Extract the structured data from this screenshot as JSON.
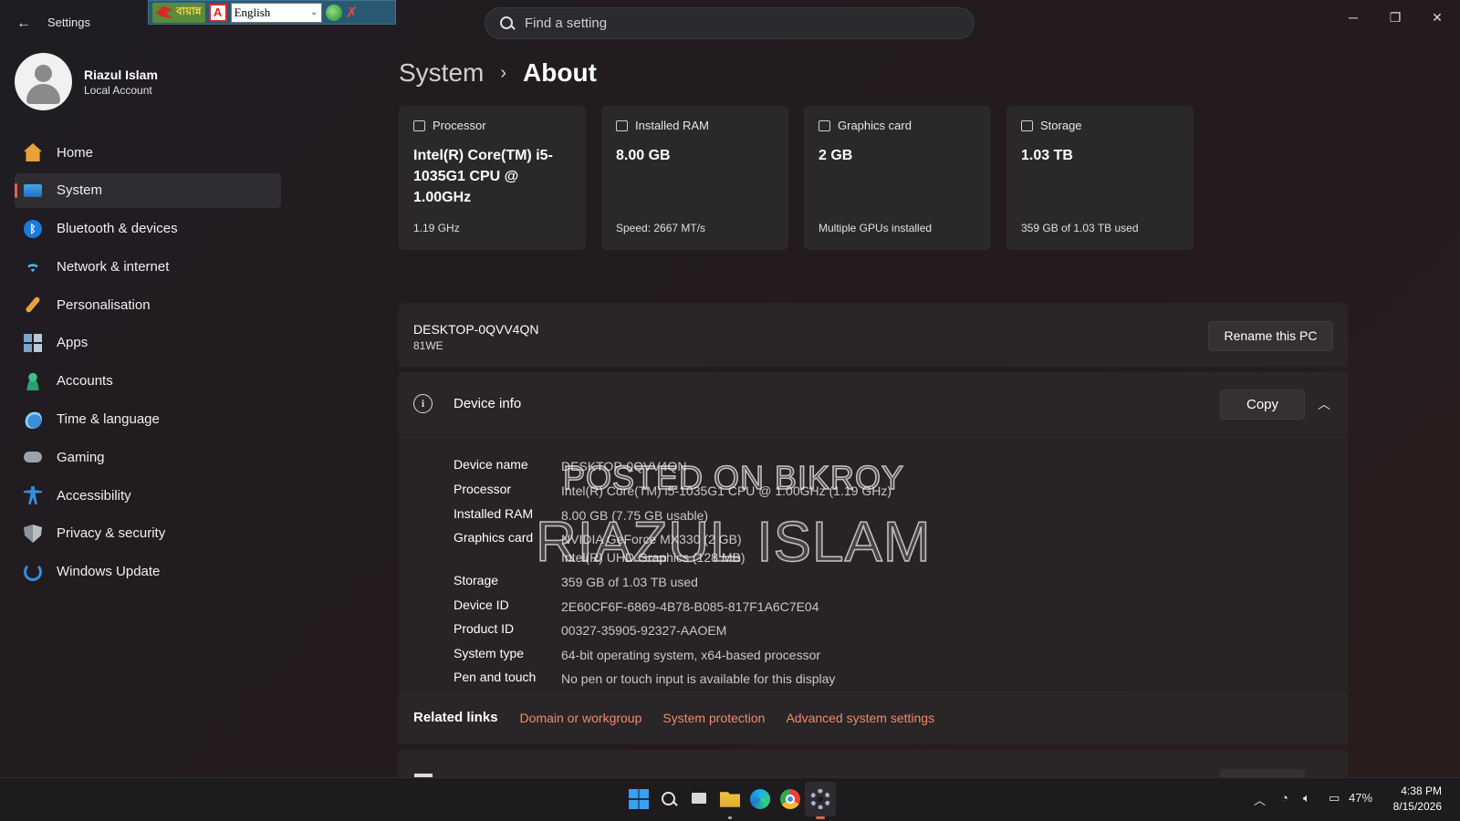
{
  "window": {
    "app_title": "Settings",
    "back_icon": "arrow-left-icon",
    "minimize_icon": "minimize-icon",
    "restore_icon": "restore-icon",
    "close_icon": "close-icon"
  },
  "ime_toolbar": {
    "brand_text": "বায়ান্ন",
    "language": "English"
  },
  "search": {
    "placeholder": "Find a setting"
  },
  "user": {
    "name": "Riazul Islam",
    "account_type": "Local Account"
  },
  "sidebar": {
    "items": [
      {
        "label": "Home",
        "icon": "home-icon",
        "active": false
      },
      {
        "label": "System",
        "icon": "system-icon",
        "active": true
      },
      {
        "label": "Bluetooth & devices",
        "icon": "bluetooth-icon",
        "active": false
      },
      {
        "label": "Network & internet",
        "icon": "wifi-icon",
        "active": false
      },
      {
        "label": "Personalisation",
        "icon": "brush-icon",
        "active": false
      },
      {
        "label": "Apps",
        "icon": "apps-icon",
        "active": false
      },
      {
        "label": "Accounts",
        "icon": "accounts-icon",
        "active": false
      },
      {
        "label": "Time & language",
        "icon": "globe-clock-icon",
        "active": false
      },
      {
        "label": "Gaming",
        "icon": "gamepad-icon",
        "active": false
      },
      {
        "label": "Accessibility",
        "icon": "accessibility-icon",
        "active": false
      },
      {
        "label": "Privacy & security",
        "icon": "shield-icon",
        "active": false
      },
      {
        "label": "Windows Update",
        "icon": "update-icon",
        "active": false
      }
    ]
  },
  "breadcrumb": {
    "parent": "System",
    "separator": "›",
    "current": "About"
  },
  "specs": [
    {
      "title": "Processor",
      "icon": "cpu-icon",
      "value": "Intel(R) Core(TM) i5-1035G1 CPU @ 1.00GHz",
      "sub": "1.19 GHz"
    },
    {
      "title": "Installed RAM",
      "icon": "ram-icon",
      "value": "8.00 GB",
      "sub": "Speed: 2667 MT/s"
    },
    {
      "title": "Graphics card",
      "icon": "gpu-icon",
      "value": "2 GB",
      "sub": "Multiple GPUs installed"
    },
    {
      "title": "Storage",
      "icon": "storage-icon",
      "value": "1.03 TB",
      "sub": "359 GB of 1.03 TB used"
    }
  ],
  "pc": {
    "name": "DESKTOP-0QVV4QN",
    "model": "81WE",
    "rename_label": "Rename this PC"
  },
  "device_info": {
    "title": "Device info",
    "copy_label": "Copy",
    "rows": [
      {
        "label": "Device name",
        "value": "DESKTOP-0QVV4QN"
      },
      {
        "label": "Processor",
        "value": "Intel(R) Core(TM) i5-1035G1 CPU @ 1.00GHz (1.19 GHz)"
      },
      {
        "label": "Installed RAM",
        "value": "8.00 GB (7.75 GB usable)"
      },
      {
        "label": "Graphics card",
        "value": "NVIDIA GeForce MX330 (2 GB)",
        "value2": "Intel(R) UHD Graphics (128 MB)"
      },
      {
        "label": "Storage",
        "value": "359 GB of 1.03 TB used"
      },
      {
        "label": "Device ID",
        "value": "2E60CF6F-6869-4B78-B085-817F1A6C7E04"
      },
      {
        "label": "Product ID",
        "value": "00327-35905-92327-AAOEM"
      },
      {
        "label": "System type",
        "value": "64-bit operating system, x64-based processor"
      },
      {
        "label": "Pen and touch",
        "value": "No pen or touch input is available for this display"
      }
    ]
  },
  "watermark": {
    "line1": "POSTED ON BIKROY",
    "line2": "RIAZUL ISLAM"
  },
  "related_links": {
    "label": "Related links",
    "links": [
      "Domain or workgroup",
      "System protection",
      "Advanced system settings"
    ]
  },
  "taskbar": {
    "icons": [
      "windows-start-icon",
      "search-icon",
      "task-view-icon",
      "file-explorer-icon",
      "edge-icon",
      "chrome-icon",
      "settings-icon"
    ],
    "battery": "47%",
    "time": "4:38 PM",
    "date": "8/15/2026"
  },
  "colors": {
    "accent": "#e0614e",
    "link": "#f08a6e"
  }
}
